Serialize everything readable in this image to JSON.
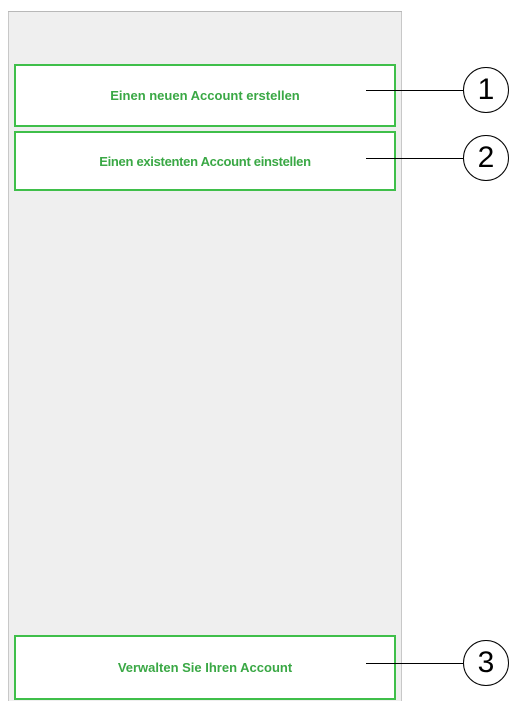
{
  "colors": {
    "panel_bg": "#efefef",
    "button_border": "#3fbf4a",
    "button_text": "#3aa845"
  },
  "buttons": {
    "create_new_account": "Einen neuen Account erstellen",
    "set_up_existing_account": "Einen existenten Account einstellen",
    "manage_account": "Verwalten Sie Ihren Account"
  },
  "callouts": {
    "one": "1",
    "two": "2",
    "three": "3"
  }
}
